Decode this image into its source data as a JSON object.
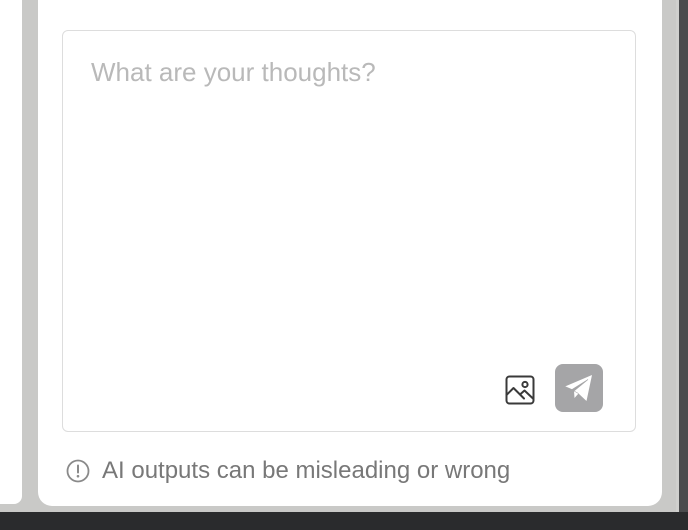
{
  "composer": {
    "placeholder": "What are your thoughts?",
    "value": "",
    "image_icon": "image-icon",
    "send_icon": "send-icon",
    "send_button_color": "#a5a5a7"
  },
  "disclaimer": {
    "icon": "info-circle-icon",
    "text": "AI outputs can be misleading or wrong"
  }
}
